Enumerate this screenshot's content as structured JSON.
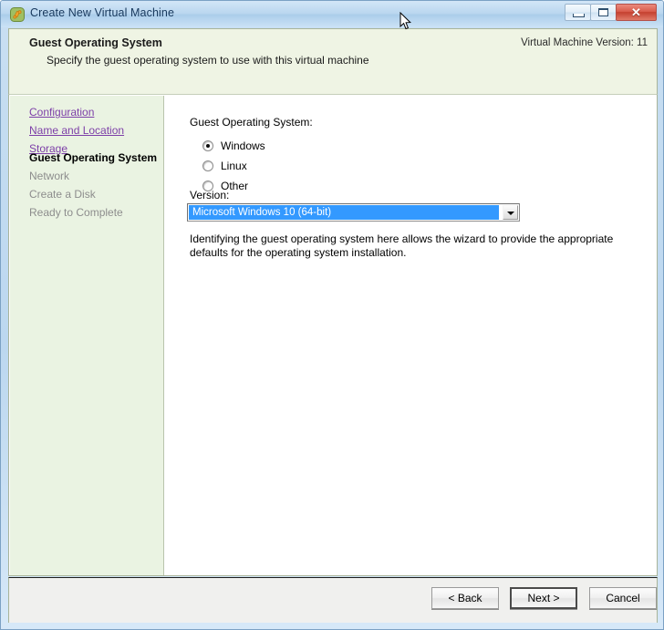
{
  "window": {
    "title": "Create New Virtual Machine",
    "icon": "vm-app-icon",
    "controls": {
      "minimize": "minimize-icon",
      "maximize": "maximize-icon",
      "close_glyph": "✕"
    }
  },
  "header": {
    "title": "Guest Operating System",
    "subtitle": "Specify the guest operating system to use with this virtual machine",
    "version_note": "Virtual Machine Version: 11"
  },
  "sidebar": {
    "items": [
      {
        "label": "Configuration",
        "state": "link"
      },
      {
        "label": "Name and Location",
        "state": "link"
      },
      {
        "label": "Storage",
        "state": "link"
      },
      {
        "label": "Guest Operating System",
        "state": "current"
      },
      {
        "label": "Network",
        "state": "pending"
      },
      {
        "label": "Create a Disk",
        "state": "pending"
      },
      {
        "label": "Ready to Complete",
        "state": "pending"
      }
    ]
  },
  "main": {
    "group_label": "Guest Operating System:",
    "options": [
      {
        "label": "Windows",
        "selected": true
      },
      {
        "label": "Linux",
        "selected": false
      },
      {
        "label": "Other",
        "selected": false
      }
    ],
    "version_label": "Version:",
    "version_value": "Microsoft Windows 10 (64-bit)",
    "version_arrow": "chevron-down-icon",
    "description": "Identifying the guest operating system here allows the wizard to provide the appropriate defaults for the operating system installation."
  },
  "footer": {
    "back_label": "< Back",
    "next_label": "Next >",
    "cancel_label": "Cancel"
  },
  "colors": {
    "titlebar_blue": "#bcd7ef",
    "header_green": "#eff4e4",
    "sidebar_green": "#eaf3e2",
    "link_purple": "#7d3fa8",
    "selection_blue": "#3399ff",
    "close_red": "#c4402f"
  }
}
